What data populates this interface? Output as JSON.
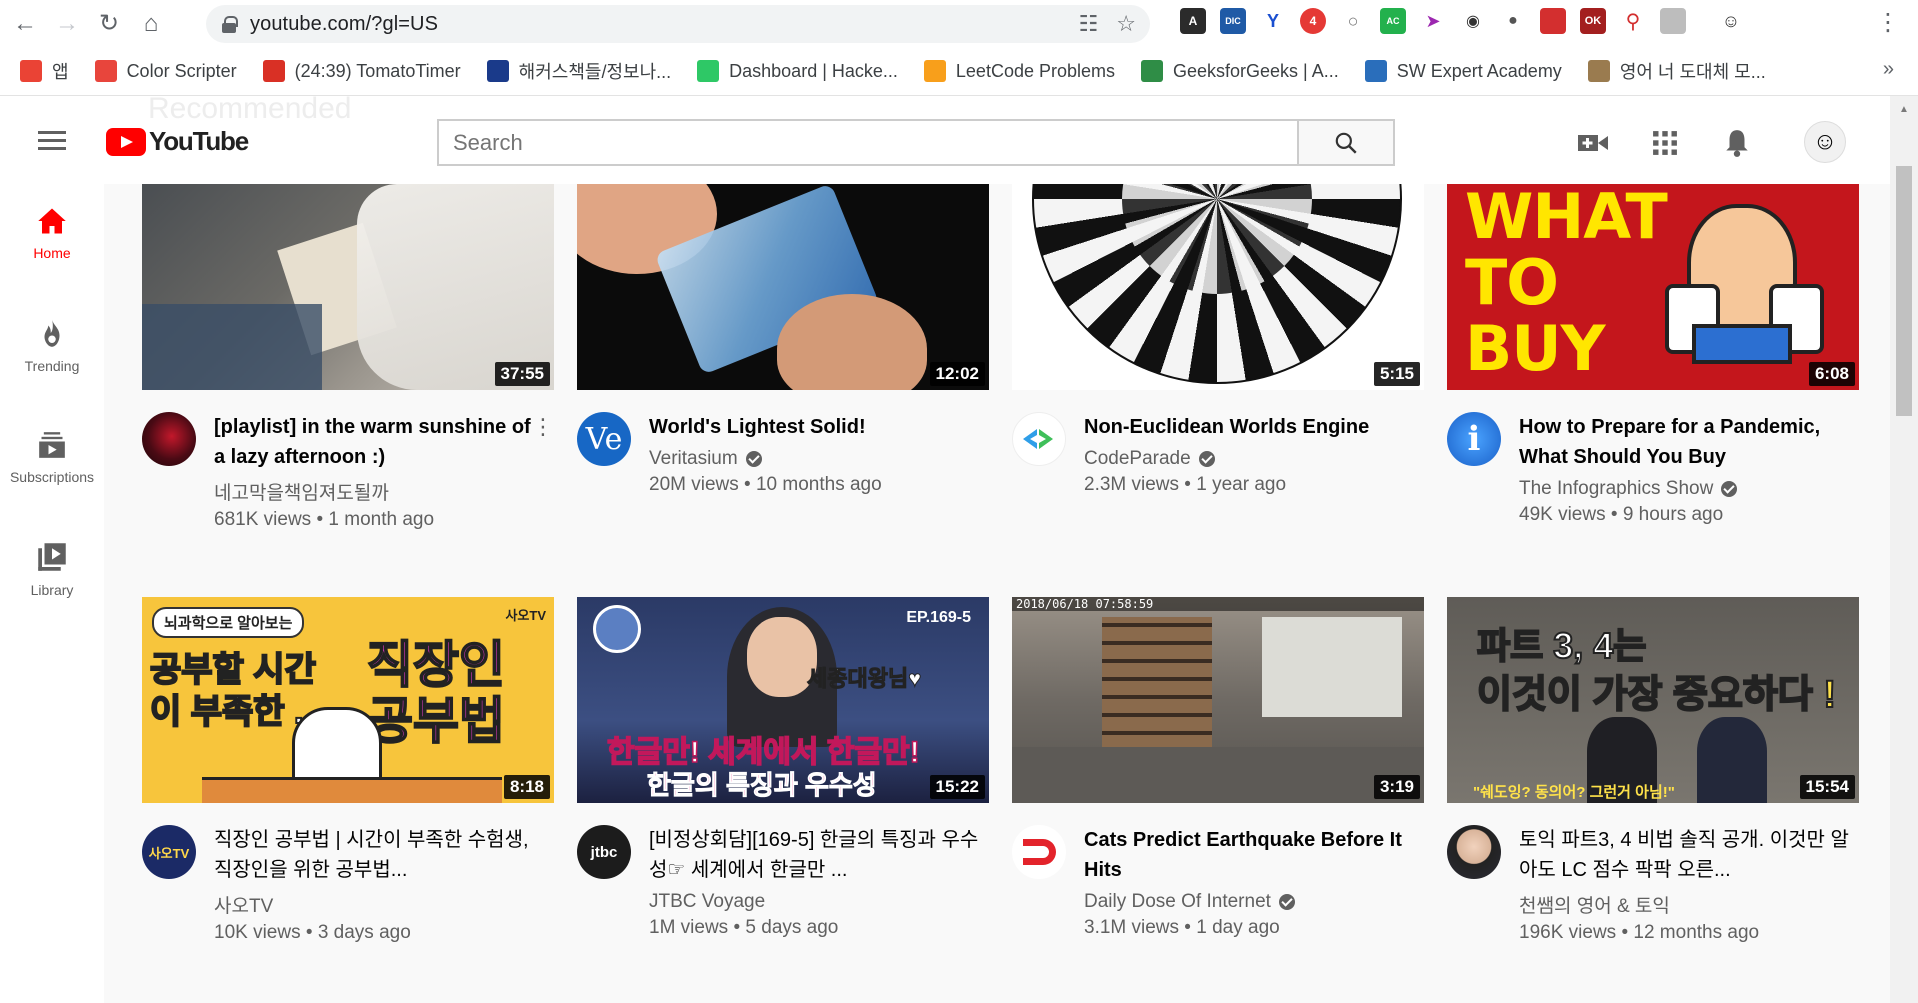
{
  "browser": {
    "url": "youtube.com/?gl=US",
    "bookmarks": [
      {
        "label": "앱",
        "icon": "apps-grid-icon",
        "color": "#ea4335"
      },
      {
        "label": "Color Scripter",
        "icon": "color-scripter-icon",
        "color": "#e8453c"
      },
      {
        "label": "(24:39) TomatoTimer",
        "icon": "tomato-icon",
        "color": "#d93025"
      },
      {
        "label": "해커스책들/정보나...",
        "icon": "hackers-h-icon",
        "color": "#1a3a8a"
      },
      {
        "label": "Dashboard | Hacke...",
        "icon": "hackerrank-icon",
        "color": "#2ec866"
      },
      {
        "label": "LeetCode Problems",
        "icon": "leetcode-icon",
        "color": "#f89f1b"
      },
      {
        "label": "GeeksforGeeks | A...",
        "icon": "geeksforgeeks-icon",
        "color": "#2f8d46"
      },
      {
        "label": "SW Expert Academy",
        "icon": "swea-icon",
        "color": "#2a6ebb"
      },
      {
        "label": "영어 너 도대체 모...",
        "icon": "bookmark-image-icon",
        "color": "#9a7b4f"
      }
    ]
  },
  "youtube": {
    "logo_text": "YouTube",
    "ghost_heading": "Recommended",
    "search_placeholder": "Search",
    "sidebar": [
      {
        "label": "Home",
        "icon": "home-icon"
      },
      {
        "label": "Trending",
        "icon": "trending-flame-icon"
      },
      {
        "label": "Subscriptions",
        "icon": "subscriptions-icon"
      },
      {
        "label": "Library",
        "icon": "library-icon"
      }
    ],
    "videos": [
      {
        "title": "[playlist] in the warm sunshine of a lazy afternoon :)",
        "channel": "네고막을책임져도될까",
        "verified": false,
        "views": "681K views",
        "age": "1 month ago",
        "duration": "37:55",
        "avatar_text": ""
      },
      {
        "title": "World's Lightest Solid!",
        "channel": "Veritasium",
        "verified": true,
        "views": "20M views",
        "age": "10 months ago",
        "duration": "12:02",
        "avatar_text": "Ve"
      },
      {
        "title": "Non-Euclidean Worlds Engine",
        "channel": "CodeParade",
        "verified": true,
        "views": "2.3M views",
        "age": "1 year ago",
        "duration": "5:15",
        "avatar_text": "<P"
      },
      {
        "title": "How to Prepare for a Pandemic, What Should You Buy",
        "channel": "The Infographics Show",
        "verified": true,
        "views": "49K views",
        "age": "9 hours ago",
        "duration": "6:08",
        "avatar_text": "i"
      },
      {
        "title": "직장인 공부법 | 시간이 부족한 수험생, 직장인을 위한 공부법...",
        "channel": "사오TV",
        "verified": false,
        "views": "10K views",
        "age": "3 days ago",
        "duration": "8:18",
        "avatar_text": "사오TV"
      },
      {
        "title": "[비정상회담][169-5] 한글의 특징과 우수성☞ 세계에서 한글만 ...",
        "channel": "JTBC Voyage",
        "verified": false,
        "views": "1M views",
        "age": "5 days ago",
        "duration": "15:22",
        "avatar_text": "jtbc"
      },
      {
        "title": "Cats Predict Earthquake Before It Hits",
        "channel": "Daily Dose Of Internet",
        "verified": true,
        "views": "3.1M views",
        "age": "1 day ago",
        "duration": "3:19",
        "avatar_text": ""
      },
      {
        "title": "토익 파트3, 4 비법 솔직 공개. 이것만 알아도 LC 점수 팍팍 오른...",
        "channel": "천쌤의 영어 & 토익",
        "verified": false,
        "views": "196K views",
        "age": "12 months ago",
        "duration": "15:54",
        "avatar_text": ""
      }
    ],
    "thumb_text": {
      "what_to_buy": "WHAT TO BUY",
      "study_tag": "뇌과학으로 알아보는",
      "study_brand": "사오TV",
      "study_line1": "공부할 시간이 부족한 ...",
      "study_line2": "직장인 공부법",
      "jtbc_ep": "EP.169-5",
      "jtbc_name": "세종대왕님♥",
      "jtbc_line1": "한글만! 세계에서 한글만!",
      "jtbc_line2": "한글의 특징과 우수성",
      "cat_timestamp": "2018/06/18 07:58:59",
      "toeic_line1": "파트 3, 4는",
      "toeic_line2": "이것이 가장 중요하다 !",
      "toeic_quote": "\"쉐도잉? 동의어? 그런거 아님!\""
    }
  }
}
